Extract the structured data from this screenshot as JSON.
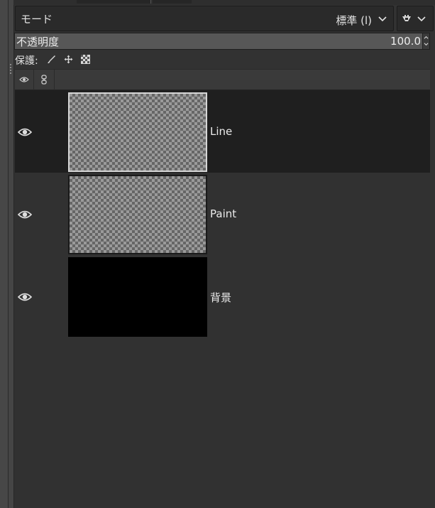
{
  "mode": {
    "label": "モード",
    "value": "標準 (l)"
  },
  "opacity": {
    "label": "不透明度",
    "value": "100.0"
  },
  "protect": {
    "label": "保護:"
  },
  "layers": [
    {
      "name": "Line",
      "selected": true,
      "thumbnail": "transparent"
    },
    {
      "name": "Paint",
      "selected": false,
      "thumbnail": "transparent"
    },
    {
      "name": "背景",
      "selected": false,
      "thumbnail": "black"
    }
  ],
  "icons": {
    "mode_chevron": "chevron-down-icon",
    "mode_extra": "lock-alpha-icon",
    "protect": [
      "paintbrush-icon",
      "move-icon",
      "alpha-lock-icon"
    ],
    "header": [
      "eye-icon",
      "chain-icon"
    ],
    "layer_visibility": "eye-icon"
  },
  "colors": {
    "panel": "#323232",
    "selected_row": "#1f1f1f",
    "text": "#e2e2e2"
  }
}
